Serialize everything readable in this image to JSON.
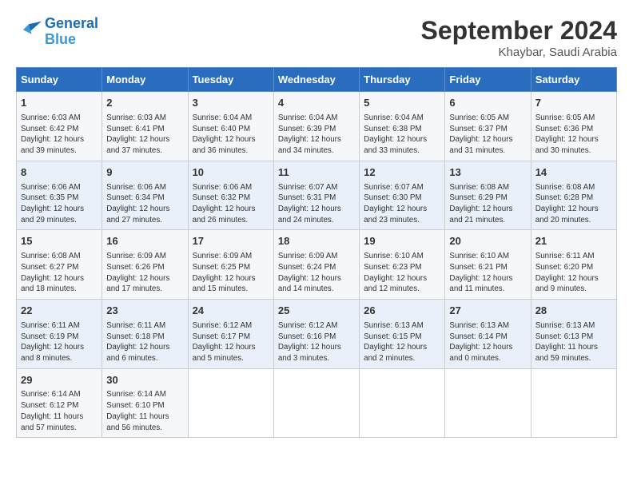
{
  "logo": {
    "line1": "General",
    "line2": "Blue"
  },
  "title": "September 2024",
  "location": "Khaybar, Saudi Arabia",
  "days_of_week": [
    "Sunday",
    "Monday",
    "Tuesday",
    "Wednesday",
    "Thursday",
    "Friday",
    "Saturday"
  ],
  "weeks": [
    [
      {
        "num": "1",
        "lines": [
          "Sunrise: 6:03 AM",
          "Sunset: 6:42 PM",
          "Daylight: 12 hours",
          "and 39 minutes."
        ]
      },
      {
        "num": "2",
        "lines": [
          "Sunrise: 6:03 AM",
          "Sunset: 6:41 PM",
          "Daylight: 12 hours",
          "and 37 minutes."
        ]
      },
      {
        "num": "3",
        "lines": [
          "Sunrise: 6:04 AM",
          "Sunset: 6:40 PM",
          "Daylight: 12 hours",
          "and 36 minutes."
        ]
      },
      {
        "num": "4",
        "lines": [
          "Sunrise: 6:04 AM",
          "Sunset: 6:39 PM",
          "Daylight: 12 hours",
          "and 34 minutes."
        ]
      },
      {
        "num": "5",
        "lines": [
          "Sunrise: 6:04 AM",
          "Sunset: 6:38 PM",
          "Daylight: 12 hours",
          "and 33 minutes."
        ]
      },
      {
        "num": "6",
        "lines": [
          "Sunrise: 6:05 AM",
          "Sunset: 6:37 PM",
          "Daylight: 12 hours",
          "and 31 minutes."
        ]
      },
      {
        "num": "7",
        "lines": [
          "Sunrise: 6:05 AM",
          "Sunset: 6:36 PM",
          "Daylight: 12 hours",
          "and 30 minutes."
        ]
      }
    ],
    [
      {
        "num": "8",
        "lines": [
          "Sunrise: 6:06 AM",
          "Sunset: 6:35 PM",
          "Daylight: 12 hours",
          "and 29 minutes."
        ]
      },
      {
        "num": "9",
        "lines": [
          "Sunrise: 6:06 AM",
          "Sunset: 6:34 PM",
          "Daylight: 12 hours",
          "and 27 minutes."
        ]
      },
      {
        "num": "10",
        "lines": [
          "Sunrise: 6:06 AM",
          "Sunset: 6:32 PM",
          "Daylight: 12 hours",
          "and 26 minutes."
        ]
      },
      {
        "num": "11",
        "lines": [
          "Sunrise: 6:07 AM",
          "Sunset: 6:31 PM",
          "Daylight: 12 hours",
          "and 24 minutes."
        ]
      },
      {
        "num": "12",
        "lines": [
          "Sunrise: 6:07 AM",
          "Sunset: 6:30 PM",
          "Daylight: 12 hours",
          "and 23 minutes."
        ]
      },
      {
        "num": "13",
        "lines": [
          "Sunrise: 6:08 AM",
          "Sunset: 6:29 PM",
          "Daylight: 12 hours",
          "and 21 minutes."
        ]
      },
      {
        "num": "14",
        "lines": [
          "Sunrise: 6:08 AM",
          "Sunset: 6:28 PM",
          "Daylight: 12 hours",
          "and 20 minutes."
        ]
      }
    ],
    [
      {
        "num": "15",
        "lines": [
          "Sunrise: 6:08 AM",
          "Sunset: 6:27 PM",
          "Daylight: 12 hours",
          "and 18 minutes."
        ]
      },
      {
        "num": "16",
        "lines": [
          "Sunrise: 6:09 AM",
          "Sunset: 6:26 PM",
          "Daylight: 12 hours",
          "and 17 minutes."
        ]
      },
      {
        "num": "17",
        "lines": [
          "Sunrise: 6:09 AM",
          "Sunset: 6:25 PM",
          "Daylight: 12 hours",
          "and 15 minutes."
        ]
      },
      {
        "num": "18",
        "lines": [
          "Sunrise: 6:09 AM",
          "Sunset: 6:24 PM",
          "Daylight: 12 hours",
          "and 14 minutes."
        ]
      },
      {
        "num": "19",
        "lines": [
          "Sunrise: 6:10 AM",
          "Sunset: 6:23 PM",
          "Daylight: 12 hours",
          "and 12 minutes."
        ]
      },
      {
        "num": "20",
        "lines": [
          "Sunrise: 6:10 AM",
          "Sunset: 6:21 PM",
          "Daylight: 12 hours",
          "and 11 minutes."
        ]
      },
      {
        "num": "21",
        "lines": [
          "Sunrise: 6:11 AM",
          "Sunset: 6:20 PM",
          "Daylight: 12 hours",
          "and 9 minutes."
        ]
      }
    ],
    [
      {
        "num": "22",
        "lines": [
          "Sunrise: 6:11 AM",
          "Sunset: 6:19 PM",
          "Daylight: 12 hours",
          "and 8 minutes."
        ]
      },
      {
        "num": "23",
        "lines": [
          "Sunrise: 6:11 AM",
          "Sunset: 6:18 PM",
          "Daylight: 12 hours",
          "and 6 minutes."
        ]
      },
      {
        "num": "24",
        "lines": [
          "Sunrise: 6:12 AM",
          "Sunset: 6:17 PM",
          "Daylight: 12 hours",
          "and 5 minutes."
        ]
      },
      {
        "num": "25",
        "lines": [
          "Sunrise: 6:12 AM",
          "Sunset: 6:16 PM",
          "Daylight: 12 hours",
          "and 3 minutes."
        ]
      },
      {
        "num": "26",
        "lines": [
          "Sunrise: 6:13 AM",
          "Sunset: 6:15 PM",
          "Daylight: 12 hours",
          "and 2 minutes."
        ]
      },
      {
        "num": "27",
        "lines": [
          "Sunrise: 6:13 AM",
          "Sunset: 6:14 PM",
          "Daylight: 12 hours",
          "and 0 minutes."
        ]
      },
      {
        "num": "28",
        "lines": [
          "Sunrise: 6:13 AM",
          "Sunset: 6:13 PM",
          "Daylight: 11 hours",
          "and 59 minutes."
        ]
      }
    ],
    [
      {
        "num": "29",
        "lines": [
          "Sunrise: 6:14 AM",
          "Sunset: 6:12 PM",
          "Daylight: 11 hours",
          "and 57 minutes."
        ]
      },
      {
        "num": "30",
        "lines": [
          "Sunrise: 6:14 AM",
          "Sunset: 6:10 PM",
          "Daylight: 11 hours",
          "and 56 minutes."
        ]
      },
      {
        "num": "",
        "lines": []
      },
      {
        "num": "",
        "lines": []
      },
      {
        "num": "",
        "lines": []
      },
      {
        "num": "",
        "lines": []
      },
      {
        "num": "",
        "lines": []
      }
    ]
  ]
}
